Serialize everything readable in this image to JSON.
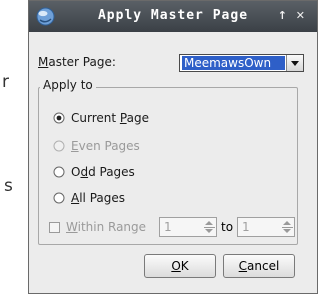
{
  "background": {
    "left_chars": [
      "r",
      "s"
    ]
  },
  "window": {
    "title": "Apply Master Page",
    "btn_pin": "↑",
    "btn_close": "✕"
  },
  "master_page": {
    "label": "Master Page:",
    "value": "MeemawsOwn"
  },
  "apply_to": {
    "title": "Apply to",
    "options": [
      {
        "label": "Current Page",
        "checked": true,
        "enabled": true
      },
      {
        "label": "Even Pages",
        "checked": false,
        "enabled": false
      },
      {
        "label": "Odd Pages",
        "checked": false,
        "enabled": true
      },
      {
        "label": "All Pages",
        "checked": false,
        "enabled": true
      }
    ],
    "range": {
      "label": "Within Range",
      "from": "1",
      "to_label": "to",
      "to": "1",
      "enabled": false
    }
  },
  "buttons": {
    "ok": "OK",
    "cancel": "Cancel"
  },
  "colors": {
    "titlebar": "#474c52",
    "selection": "#2e5fc8",
    "dialog_bg": "#ececec"
  }
}
